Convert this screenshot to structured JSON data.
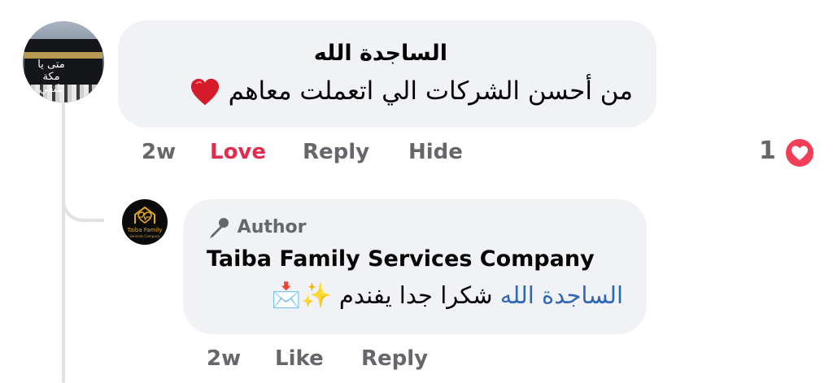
{
  "comment": {
    "author": "الساجدة الله",
    "text": "من أحسن الشركات الي اتعملت معاهم",
    "avatar_text": "متى يا مكة نلتقي",
    "time": "2w",
    "love_label": "Love",
    "reply_label": "Reply",
    "hide_label": "Hide",
    "reaction_count": "1",
    "reaction_icon": "love-reaction-icon"
  },
  "reply": {
    "badge": "Author",
    "author": "Taiba Family Services Company",
    "mention": "الساجدة الله",
    "text": "شكرا جدا يفندم",
    "emoji_1": "✨",
    "emoji_2": "📩",
    "logo_name": "Taiba Family",
    "logo_sub": "Services Company",
    "time": "2w",
    "like_label": "Like",
    "reply_label": "Reply"
  },
  "colors": {
    "bubble_bg": "#f0f2f5",
    "love_red": "#e22c4f",
    "mention_blue": "#2f68b7",
    "muted_gray": "#65676b",
    "reaction_red": "#f33e58"
  }
}
